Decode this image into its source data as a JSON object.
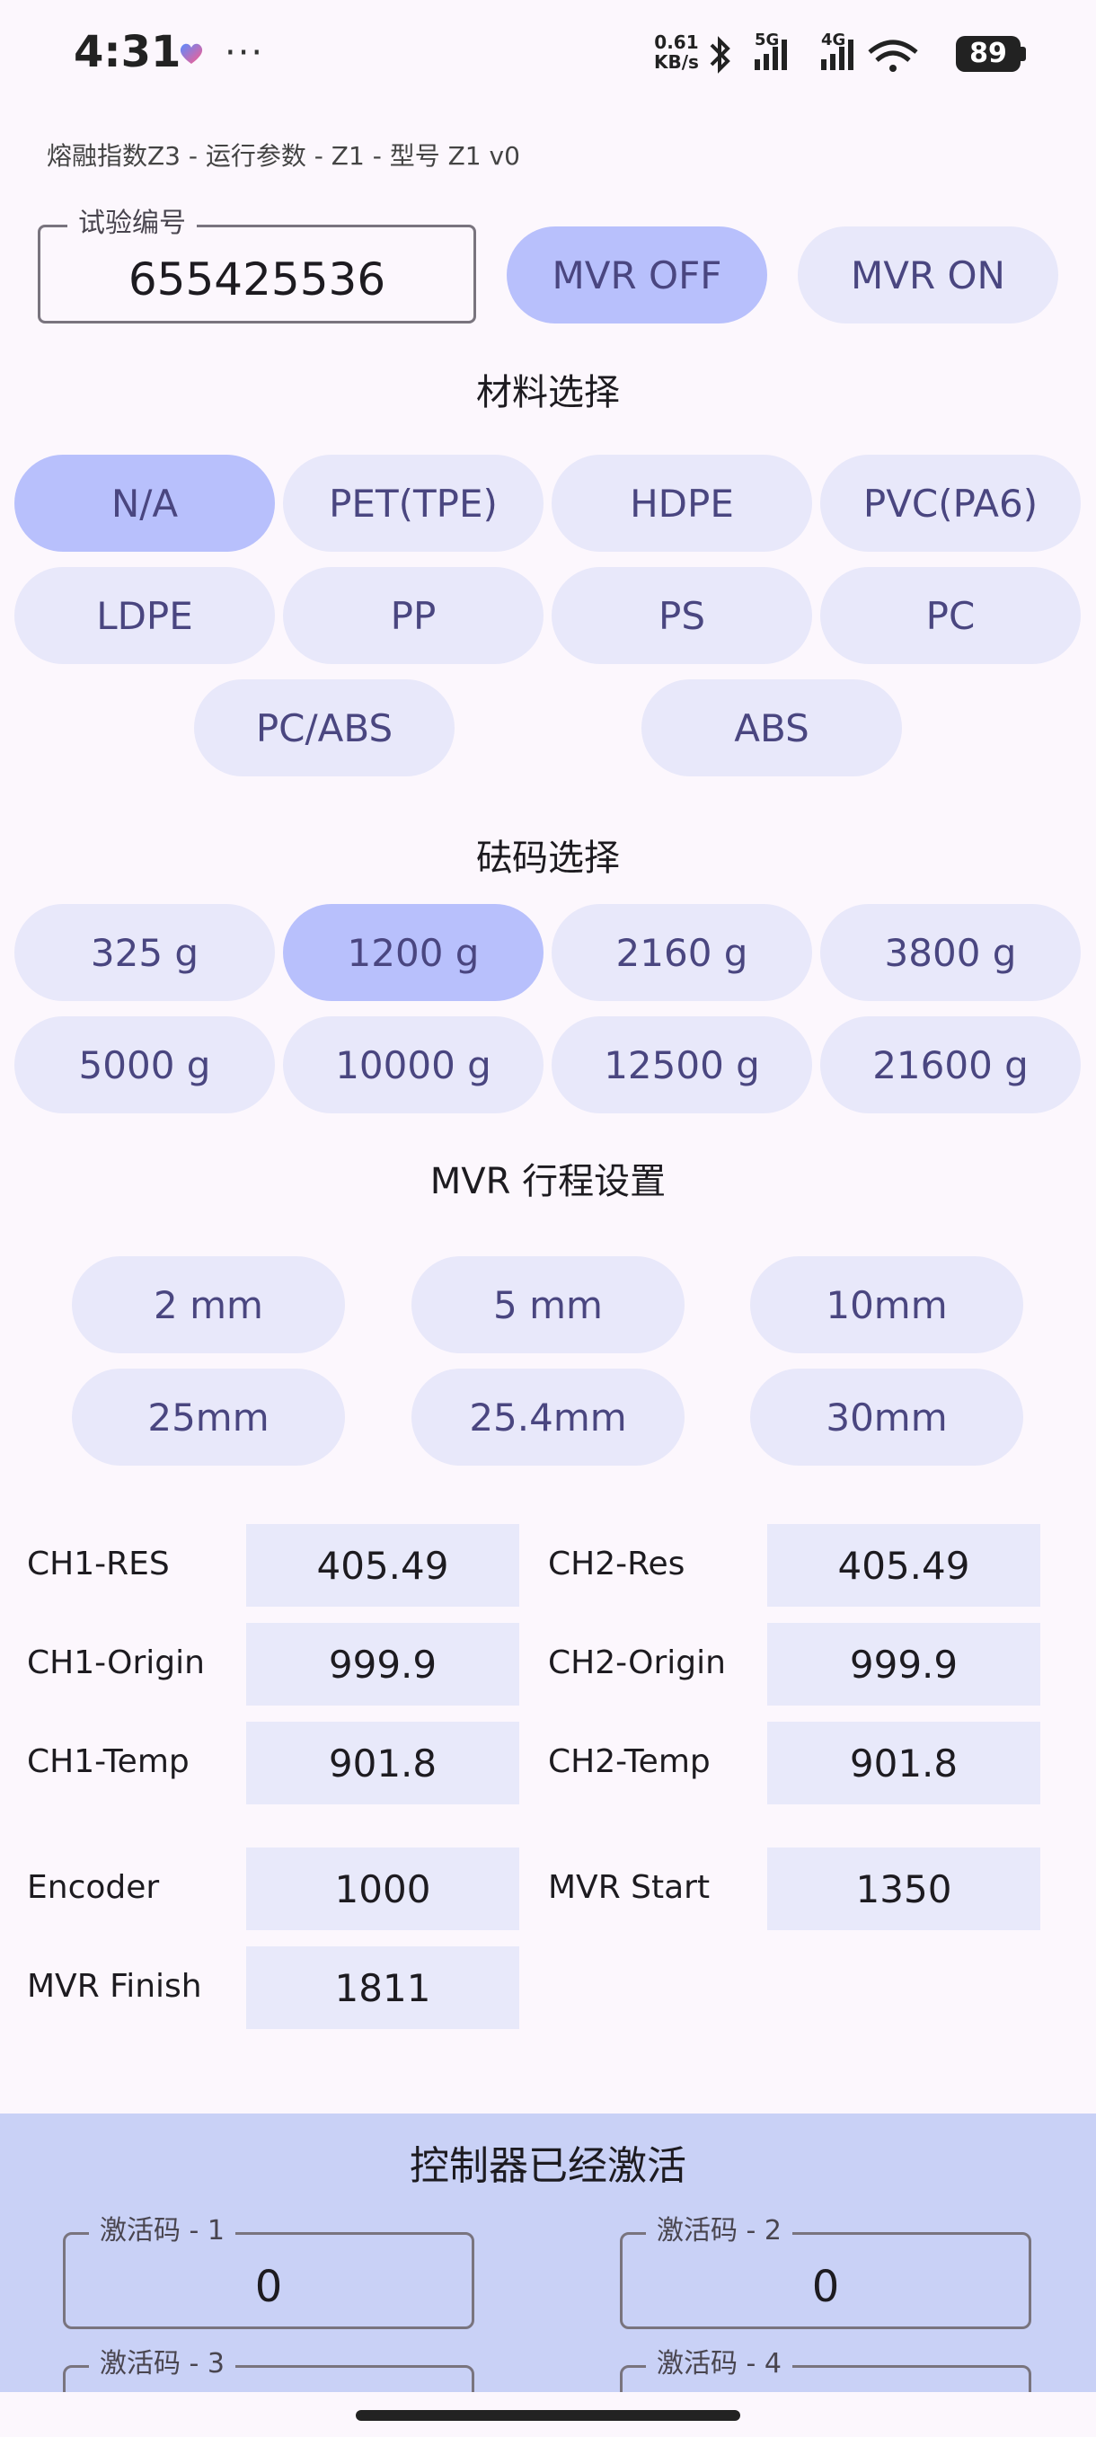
{
  "status_bar": {
    "time": "4:31",
    "dots": "···",
    "speed_value": "0.61",
    "speed_unit": "KB/s",
    "net_5g": "5G",
    "net_4g": "4G",
    "battery": "89",
    "icons": [
      "heart-icon",
      "bluetooth-icon",
      "signal-icon",
      "wifi-icon",
      "battery-icon"
    ]
  },
  "app_title": "熔融指数Z3 - 运行参数 - Z1 - 型号 Z1 v0",
  "test_number": {
    "label": "试验编号",
    "value": "655425536"
  },
  "mvr_toggle": {
    "off_label": "MVR OFF",
    "on_label": "MVR ON",
    "selected": "off"
  },
  "material": {
    "title": "材料选择",
    "options": [
      "N/A",
      "PET(TPE)",
      "HDPE",
      "PVC(PA6)",
      "LDPE",
      "PP",
      "PS",
      "PC",
      "PC/ABS",
      "ABS"
    ],
    "selected": "N/A"
  },
  "weight": {
    "title": "砝码选择",
    "options": [
      "325 g",
      "1200 g",
      "2160 g",
      "3800 g",
      "5000 g",
      "10000 g",
      "12500 g",
      "21600 g"
    ],
    "selected": "1200 g"
  },
  "stroke": {
    "title": "MVR 行程设置",
    "options": [
      "2 mm",
      "5 mm",
      "10mm",
      "25mm",
      "25.4mm",
      "30mm"
    ]
  },
  "readings": {
    "ch1_res": {
      "label": "CH1-RES",
      "value": "405.49"
    },
    "ch2_res": {
      "label": "CH2-Res",
      "value": "405.49"
    },
    "ch1_origin": {
      "label": "CH1-Origin",
      "value": "999.9"
    },
    "ch2_origin": {
      "label": "CH2-Origin",
      "value": "999.9"
    },
    "ch1_temp": {
      "label": "CH1-Temp",
      "value": "901.8"
    },
    "ch2_temp": {
      "label": "CH2-Temp",
      "value": "901.8"
    },
    "encoder": {
      "label": "Encoder",
      "value": "1000"
    },
    "mvr_start": {
      "label": "MVR Start",
      "value": "1350"
    },
    "mvr_finish": {
      "label": "MVR Finish",
      "value": "1811"
    }
  },
  "activation": {
    "title": "控制器已经激活",
    "codes": [
      {
        "label": "激活码 - 1",
        "value": "0"
      },
      {
        "label": "激活码 - 2",
        "value": "0"
      },
      {
        "label": "激活码 - 3",
        "value": ""
      },
      {
        "label": "激活码 - 4",
        "value": ""
      }
    ]
  },
  "colors": {
    "background": "#fcf7fd",
    "pill": "#e8e8fa",
    "pill_selected": "#b8c0fc",
    "pill_text": "#4a4680",
    "value_box": "#e8e9fa",
    "panel": "#c9d1f6"
  }
}
